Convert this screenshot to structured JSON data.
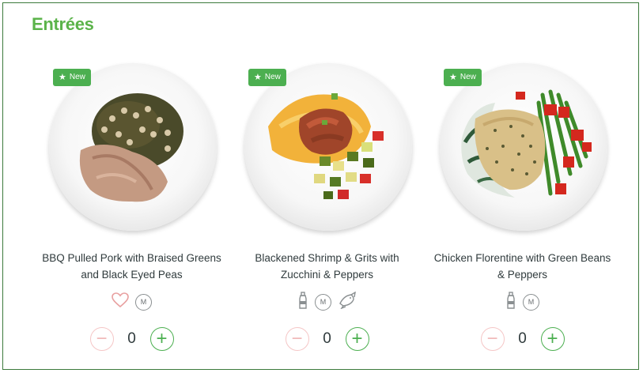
{
  "section": {
    "title": "Entrées"
  },
  "cards": [
    {
      "badge": "New",
      "badge_icon": "star-icon",
      "name_line1": "BBQ Pulled Pork with Braised Greens",
      "name_line2": "and Black Eyed Peas",
      "icons": [
        "heart-icon",
        "m-icon"
      ],
      "m_label": "M",
      "quantity": "0",
      "minus_label": "−",
      "plus_label": "+"
    },
    {
      "badge": "New",
      "badge_icon": "star-icon",
      "name_line1": "Blackened Shrimp & Grits with",
      "name_line2": "Zucchini & Peppers",
      "icons": [
        "bottle-icon",
        "m-icon",
        "fish-icon"
      ],
      "m_label": "M",
      "quantity": "0",
      "minus_label": "−",
      "plus_label": "+"
    },
    {
      "badge": "New",
      "badge_icon": "star-icon",
      "name_line1": "Chicken Florentine with Green Beans",
      "name_line2": "& Peppers",
      "icons": [
        "bottle-icon",
        "m-icon"
      ],
      "m_label": "M",
      "quantity": "0",
      "minus_label": "−",
      "plus_label": "+"
    }
  ],
  "colors": {
    "accent_green": "#4caf50",
    "title_green": "#5bb34a",
    "minus_pink": "#f0b8b8",
    "heart_pink": "#e8a0a0"
  }
}
